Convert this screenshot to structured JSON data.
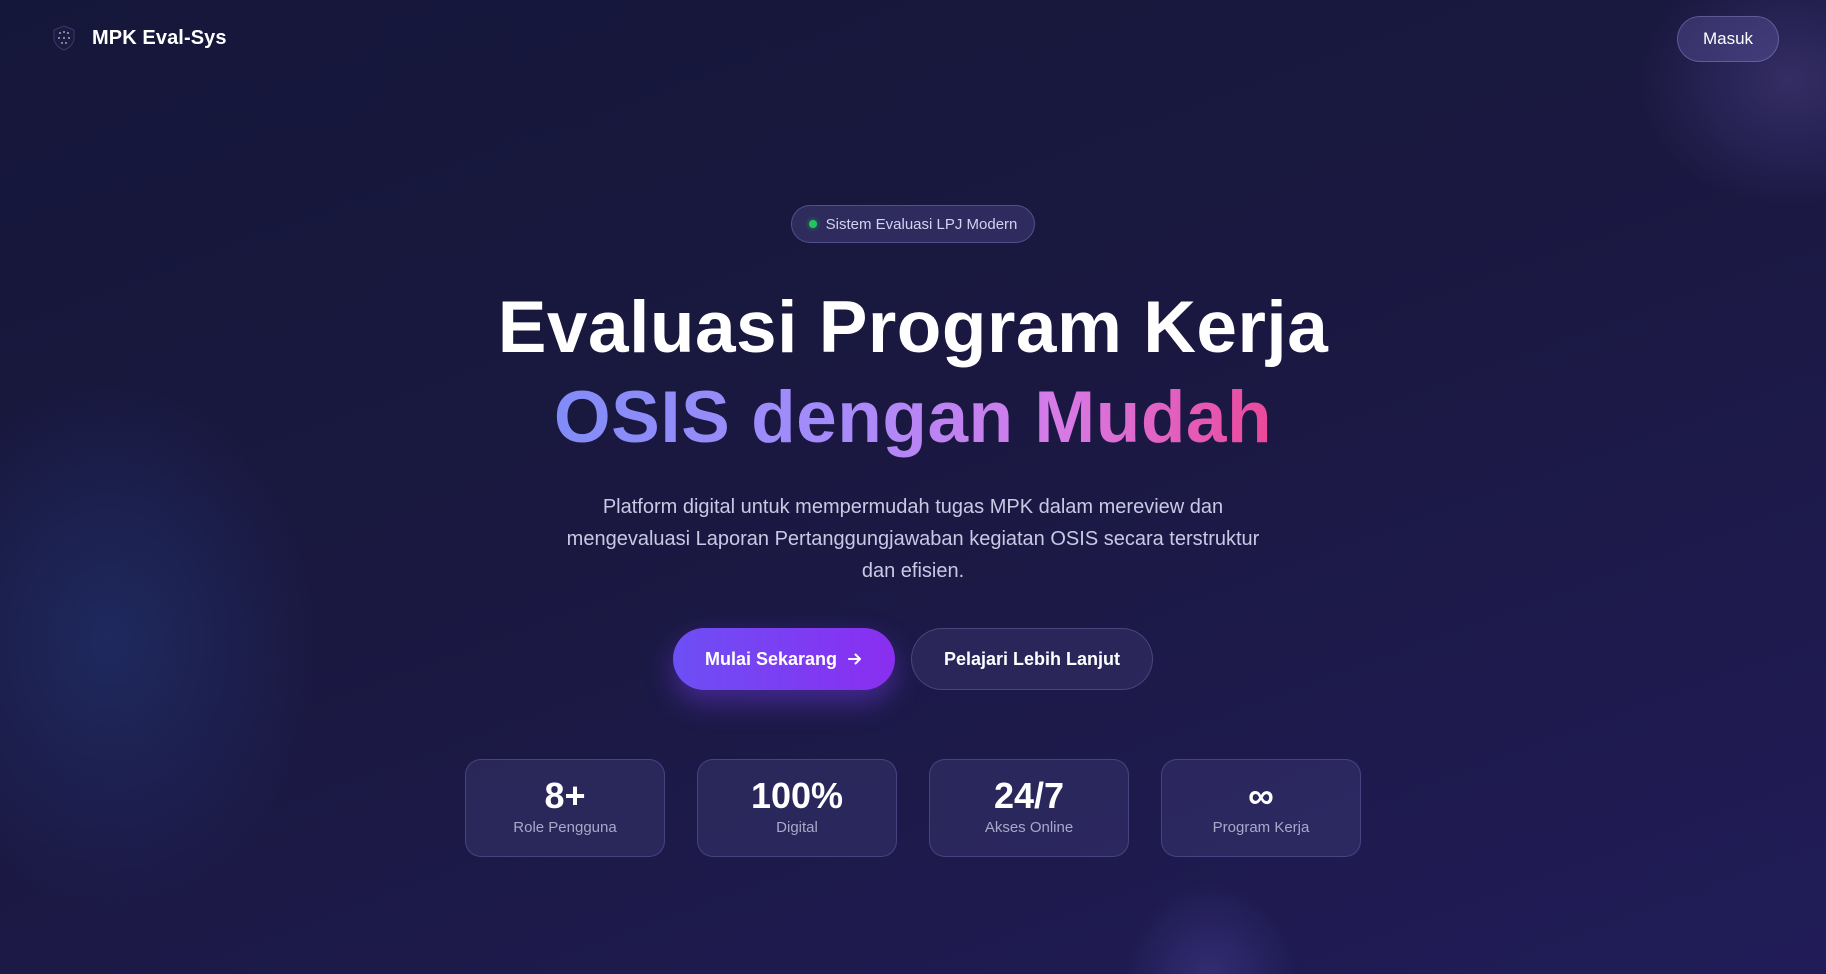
{
  "header": {
    "brand": "MPK Eval-Sys",
    "login_label": "Masuk"
  },
  "hero": {
    "badge": "Sistem Evaluasi LPJ Modern",
    "title_line1": "Evaluasi Program Kerja",
    "title_line2": "OSIS dengan Mudah",
    "description": "Platform digital untuk mempermudah tugas MPK dalam mereview dan mengevaluasi Laporan Pertanggungjawaban kegiatan OSIS secara terstruktur dan efisien.",
    "primary_cta": "Mulai Sekarang",
    "secondary_cta": "Pelajari Lebih Lanjut"
  },
  "stats": [
    {
      "value": "8+",
      "label": "Role Pengguna"
    },
    {
      "value": "100%",
      "label": "Digital"
    },
    {
      "value": "24/7",
      "label": "Akses Online"
    },
    {
      "value": "∞",
      "label": "Program Kerja"
    }
  ],
  "colors": {
    "accent_purple": "#7c3aed",
    "gradient_start": "#818cf8",
    "gradient_end": "#ec4899",
    "status_dot": "#22c55e"
  },
  "icons": {
    "brand": "shield-logo-icon",
    "cta": "arrow-right-icon"
  }
}
